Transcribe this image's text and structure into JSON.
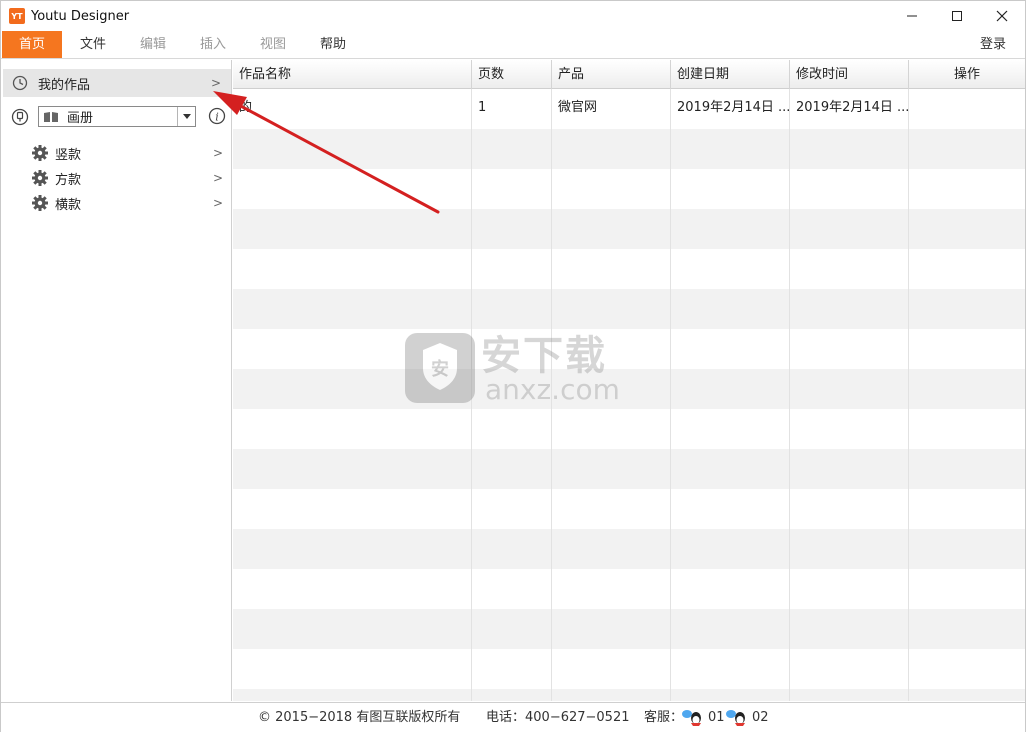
{
  "window": {
    "app_icon_text": "YT",
    "title": "Youtu Designer"
  },
  "menu": {
    "items": [
      {
        "label": "首页",
        "state": "active"
      },
      {
        "label": "文件",
        "state": "normal"
      },
      {
        "label": "编辑",
        "state": "disabled"
      },
      {
        "label": "插入",
        "state": "disabled"
      },
      {
        "label": "视图",
        "state": "disabled"
      },
      {
        "label": "帮助",
        "state": "normal"
      }
    ],
    "login_label": "登录"
  },
  "sidebar": {
    "my_works_label": "我的作品",
    "type_select_value": "画册",
    "categories": [
      {
        "label": "竖款"
      },
      {
        "label": "方款"
      },
      {
        "label": "横款"
      }
    ]
  },
  "table": {
    "columns": [
      "作品名称",
      "页数",
      "产品",
      "创建日期",
      "修改时间",
      "操作"
    ],
    "rows": [
      [
        "的",
        "1",
        "微官网",
        "2019年2月14日 ...",
        "2019年2月14日 ...",
        ""
      ]
    ]
  },
  "watermark": {
    "text_cn": "安下载",
    "text_en": "anxz.com"
  },
  "status": {
    "copyright": "© 2015−2018 有图互联版权所有",
    "phone": "电话：400−627−0521",
    "service_label": "客服：",
    "qq1": "01",
    "qq2": "02"
  },
  "colors": {
    "accent": "#f5761f",
    "arrow": "#d42020"
  }
}
